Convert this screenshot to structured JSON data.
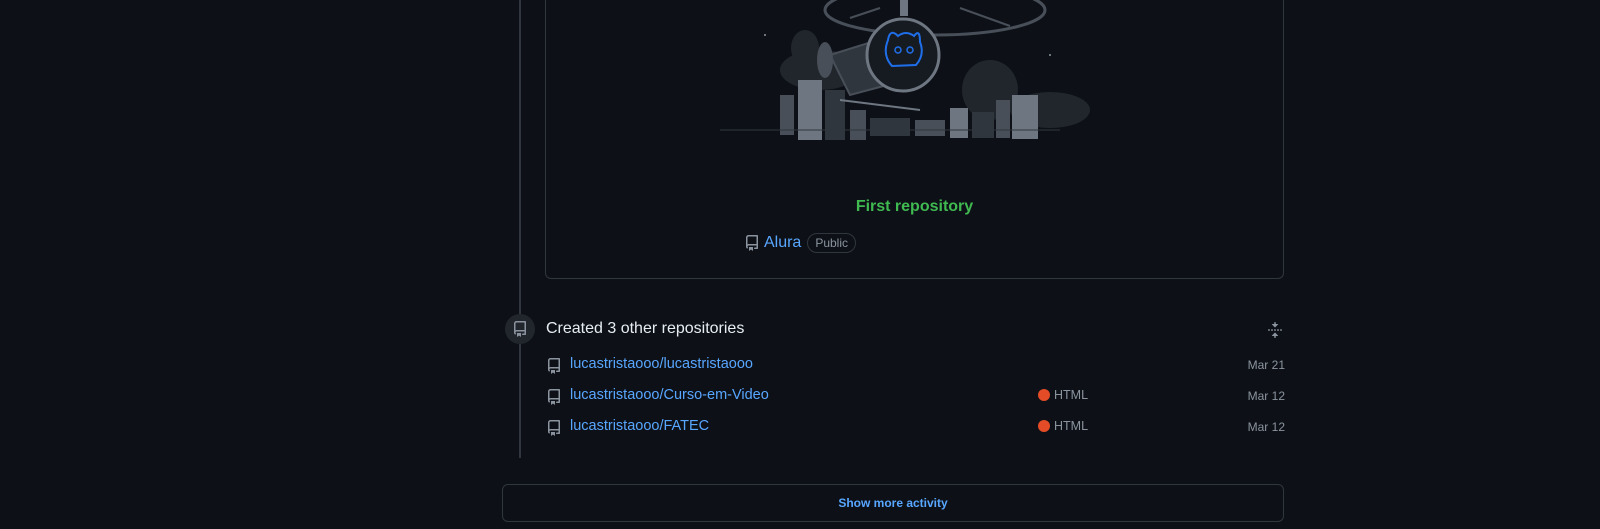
{
  "first_repo": {
    "heading": "First repository",
    "repo_name": "Alura",
    "visibility": "Public",
    "illustration_icon": "octocat-helicopter-city-illustration"
  },
  "event": {
    "title": "Created 3 other repositories",
    "icon": "repo-icon",
    "collapse_icon": "fold-icon"
  },
  "repos": [
    {
      "name": "lucastristaooo/lucastristaooo",
      "language": "",
      "language_color": "",
      "date": "Mar 21"
    },
    {
      "name": "lucastristaooo/Curso-em-Video",
      "language": "HTML",
      "language_color": "#e34c26",
      "date": "Mar 12"
    },
    {
      "name": "lucastristaooo/FATEC",
      "language": "HTML",
      "language_color": "#e34c26",
      "date": "Mar 12"
    }
  ],
  "show_more_label": "Show more activity",
  "colors": {
    "background": "#0d1117",
    "border": "#30363d",
    "link": "#58a6ff",
    "success": "#3fb950",
    "muted": "#8b949e"
  }
}
